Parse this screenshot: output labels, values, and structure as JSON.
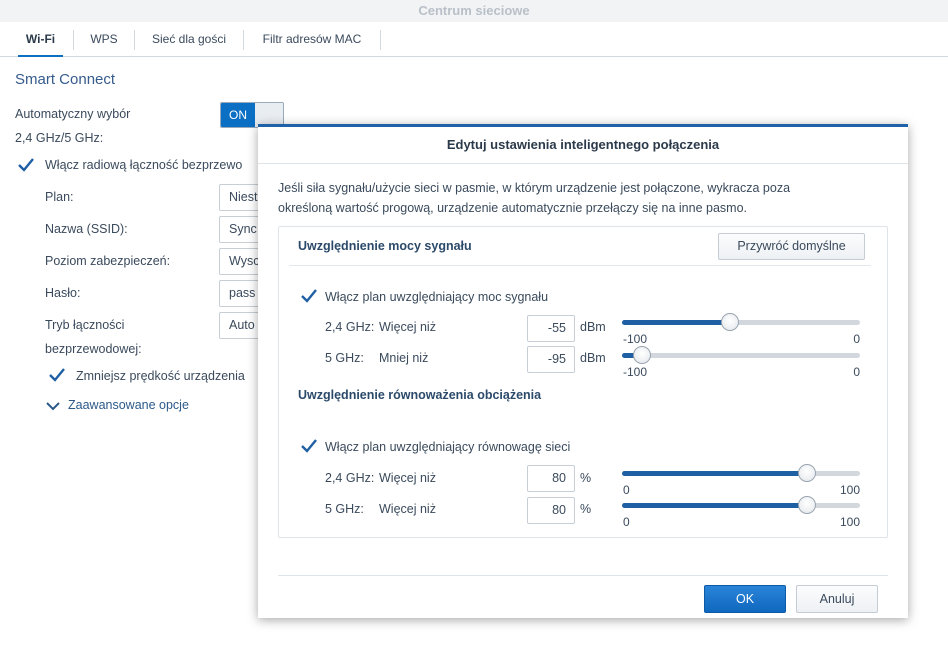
{
  "window": {
    "title": "Centrum sieciowe"
  },
  "tabs": [
    {
      "label": "Wi-Fi",
      "active": true
    },
    {
      "label": "WPS",
      "active": false
    },
    {
      "label": "Sieć dla gości",
      "active": false
    },
    {
      "label": "Filtr adresów MAC",
      "active": false
    }
  ],
  "main": {
    "section_title": "Smart Connect",
    "auto_select_label": "Automatyczny wybór",
    "auto_select_band": "2,4 GHz/5 GHz:",
    "toggle_on": "ON",
    "enable_radio_label": "Włącz radiową łączność bezprzewo",
    "fields": [
      {
        "label": "Plan:",
        "value": "Niest"
      },
      {
        "label": "Nazwa (SSID):",
        "value": "Sync"
      },
      {
        "label": "Poziom zabezpieczeń:",
        "value": "Wysc"
      },
      {
        "label": "Hasło:",
        "value": "pass"
      },
      {
        "label": "Tryb łączności",
        "label2": "bezprzewodowej:",
        "value": "Auto"
      }
    ],
    "reduce_speed_label": "Zmniejsz prędkość urządzenia",
    "advanced_label": "Zaawansowane opcje"
  },
  "dialog": {
    "title": "Edytuj ustawienia inteligentnego połączenia",
    "description_line1": "Jeśli siła sygnału/użycie sieci w pasmie, w którym urządzenie jest połączone, wykracza poza",
    "description_line2": "określoną wartość progową, urządzenie automatycznie przełączy się na inne pasmo.",
    "signal": {
      "heading": "Uwzględnienie mocy sygnału",
      "reset_button": "Przywróć domyślne",
      "enable_label": "Włącz plan uwzględniający moc sygnału",
      "rows": [
        {
          "band": "2,4 GHz:",
          "condition": "Więcej niż",
          "value": "-55",
          "unit": "dBm",
          "min": "-100",
          "max": "0",
          "fraction": 0.45
        },
        {
          "band": "5 GHz:",
          "condition": "Mniej niż",
          "value": "-95",
          "unit": "dBm",
          "min": "-100",
          "max": "0",
          "fraction": 0.05
        }
      ]
    },
    "load": {
      "heading": "Uwzględnienie równoważenia obciążenia",
      "enable_label": "Włącz plan uwzględniający równowagę sieci",
      "rows": [
        {
          "band": "2,4 GHz:",
          "condition": "Więcej niż",
          "value": "80",
          "unit": "%",
          "min": "0",
          "max": "100",
          "fraction": 0.8
        },
        {
          "band": "5 GHz:",
          "condition": "Więcej niż",
          "value": "80",
          "unit": "%",
          "min": "0",
          "max": "100",
          "fraction": 0.8
        }
      ]
    },
    "ok_button": "OK",
    "cancel_button": "Anuluj"
  },
  "colors": {
    "accent": "#0b6fc4",
    "slider_fill": "#1f5fa3",
    "heading": "#365c8c"
  },
  "icons": {
    "checkbox": "checkmark-icon",
    "advanced": "chevron-down-icon"
  }
}
